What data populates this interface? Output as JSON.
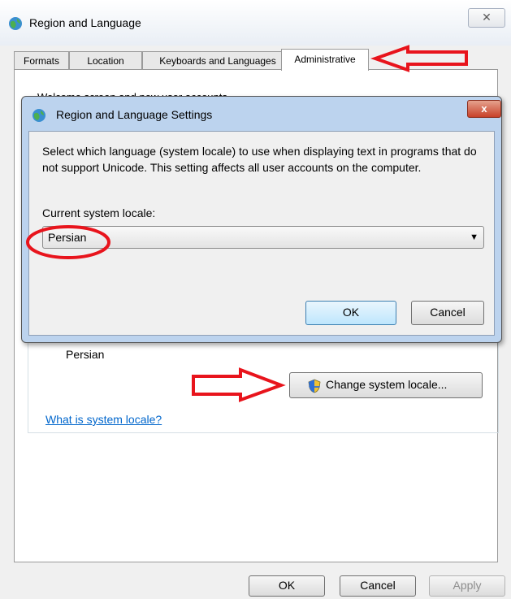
{
  "window": {
    "title": "Region and Language",
    "close_glyph": "✕"
  },
  "tabs": [
    {
      "label": "Formats",
      "active": false
    },
    {
      "label": "Location",
      "active": false
    },
    {
      "label": "Keyboards and Languages",
      "active": false
    },
    {
      "label": "Administrative",
      "active": true
    }
  ],
  "background_panel": {
    "partial_heading": "Welcome screen and new user accounts",
    "current_locale_value": "Persian",
    "change_locale_button": "Change system locale...",
    "help_link": "What is system locale?"
  },
  "footer": {
    "ok": "OK",
    "cancel": "Cancel",
    "apply": "Apply"
  },
  "dialog": {
    "title": "Region and Language Settings",
    "close_glyph": "x",
    "description": "Select which language (system locale) to use when displaying text in programs that do not support Unicode. This setting affects all user accounts on the computer.",
    "locale_label": "Current system locale:",
    "locale_value": "Persian",
    "dropdown_arrow": "▼",
    "ok": "OK",
    "cancel": "Cancel"
  },
  "annotations": {
    "color": "#e8141c"
  }
}
